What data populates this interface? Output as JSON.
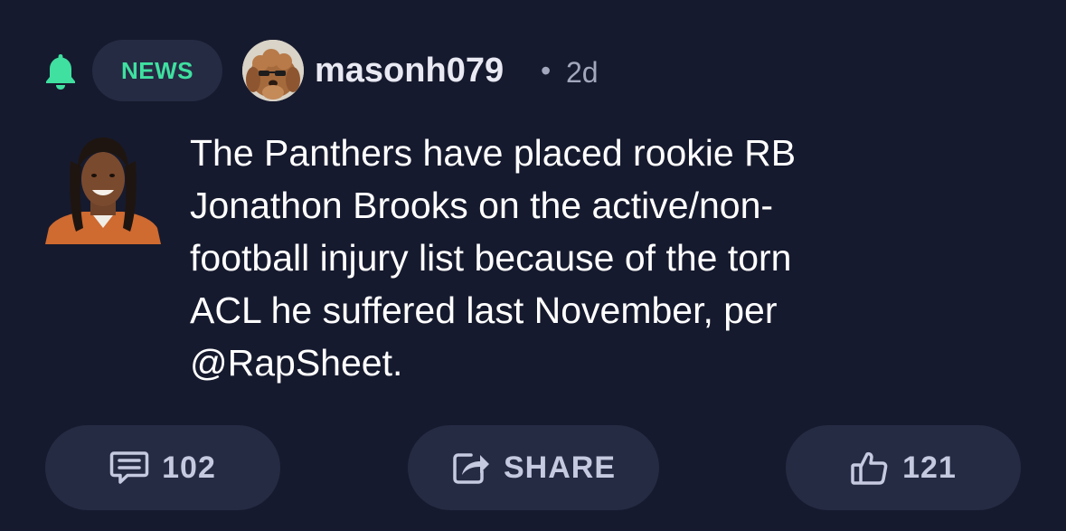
{
  "header": {
    "bell_icon": "bell-icon",
    "category": "NEWS",
    "username": "masonh079",
    "separator": "•",
    "timestamp": "2d"
  },
  "post": {
    "lines": [
      "The Panthers have placed rookie RB",
      "Jonathon Brooks on the active/non-",
      "football injury list because of the torn",
      "ACL he suffered last November, per",
      "@RapSheet."
    ]
  },
  "actions": {
    "comments": {
      "icon": "comment-icon",
      "count": "102"
    },
    "share": {
      "icon": "share-icon",
      "label": "SHARE"
    },
    "likes": {
      "icon": "thumbs-up-icon",
      "count": "121"
    }
  },
  "colors": {
    "background": "#161a2e",
    "pill": "#262b44",
    "accent_green": "#3fe0a0",
    "muted_text": "#a3a7bd",
    "button_text": "#c6cae0"
  }
}
